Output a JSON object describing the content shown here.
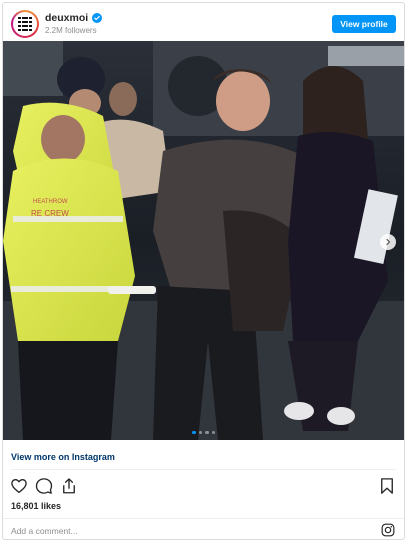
{
  "header": {
    "username": "deuxmoi",
    "verified": true,
    "followers": "2.2M followers",
    "view_profile_label": "View profile"
  },
  "post": {
    "image_description_icon": "photo",
    "carousel_slide": 1,
    "carousel_total": 4,
    "next_arrow_icon": "chevron-right-icon",
    "vest_text": "RE CREW",
    "vest_text_2": "HEATHROW"
  },
  "footer": {
    "view_more_label": "View more on Instagram",
    "likes": "16,801 likes",
    "comment_placeholder": "Add a comment...",
    "icons": [
      "heart-icon",
      "comment-icon",
      "share-icon",
      "bookmark-icon",
      "instagram-icon"
    ]
  },
  "colors": {
    "accent": "#0095f6",
    "link": "#00376b",
    "text": "#262626",
    "muted": "#8e8e8e",
    "border": "#dbdbdb"
  }
}
